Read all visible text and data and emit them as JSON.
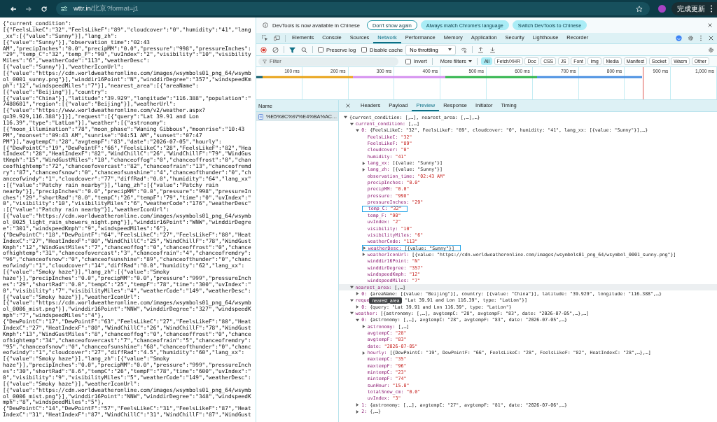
{
  "browser": {
    "url_host": "wttr.in",
    "url_rest": "/北京?format=j1",
    "update_button": "完成更新"
  },
  "raw_json_lines": [
    "{\"current_condition\":",
    "[{\"FeelsLikeC\":\"32\",\"FeelsLikeF\":\"89\",\"cloudcover\":\"0\",\"humidity\":\"41\",\"lang",
    "_xx\":[{\"value\":\"Sunny\"}],\"lang_zh\":",
    "[{\"value\":\"Sunny\"}],\"observation_time\":\"02:43",
    "AM\",\"precipInches\":\"0.0\",\"precipMM\":\"0.0\",\"pressure\":\"998\",\"pressureInches\":",
    "\"29\",\"temp_C\":\"32\",\"temp_F\":\"90\",\"uvIndex\":\"2\",\"visibility\":\"10\",\"visibility",
    "Miles\":\"6\",\"weatherCode\":\"113\",\"weatherDesc\":",
    "[{\"value\":\"Sunny\"}],\"weatherIconUrl\":",
    "[{\"value\":\"https://cdn.worldweatheronline.com/images/wsymbols01_png_64/wsymb",
    "ol_0001_sunny.png\"}],\"winddir16Point\":\"N\",\"winddirDegree\":\"357\",\"windspeedKm",
    "ph\":\"12\",\"windspeedMiles\":\"7\"}],\"nearest_area\":[{\"areaName\":",
    "[{\"value\":\"Beijing\"}],\"country\":",
    "[{\"value\":\"China\"}],\"latitude\":\"39.929\",\"longitude\":\"116.388\",\"population\":\"",
    "7480601\",\"region\":[{\"value\":\"Beijing\"}],\"weatherUrl\":",
    "[{\"value\":\"https://www.worldweatheronline.com/v2/weather.aspx?",
    "q=39.929,116.388\"}]}],\"request\":[{\"query\":\"Lat 39.91 and Lon",
    "116.39\",\"type\":\"LatLon\"}],\"weather\":[{\"astronomy\":",
    "[{\"moon_illumination\":\"78\",\"moon_phase\":\"Waning Gibbous\",\"moonrise\":\"10:43",
    "PM\",\"moonset\":\"09:43 AM\",\"sunrise\":\"04:51 AM\",\"sunset\":\"07:47",
    "PM\"}],\"avgtempC\":\"28\",\"avgtempF\":\"83\",\"date\":\"2026-07-05\",\"hourly\":",
    "[{\"DewPointC\":\"19\",\"DewPointF\":\"66\",\"FeelsLikeC\":\"28\",\"FeelsLikeF\":\"82\",\"Hea",
    "tIndexC\":\"28\",\"HeatIndexF\":\"82\",\"WindChillC\":\"26\",\"WindChillF\":\"79\",\"WindGus",
    "tKmph\":\"15\",\"WindGustMiles\":\"10\",\"chanceoffog\":\"0\",\"chanceoffrost\":\"0\",\"chan",
    "ceofhightemp\":\"72\",\"chanceofovercast\":\"82\",\"chanceofrain\":\"13\",\"chanceofremd",
    "ry\":\"87\",\"chanceofsnow\":\"0\",\"chanceofsunshine\":\"4\",\"chanceofthunder\":\"0\",\"ch",
    "anceofwindy\":\"1\",\"cloudcover\":\"77\",\"diffRad\":\"0.0\",\"humidity\":\"64\",\"lang_xx\"",
    ":[{\"value\":\"Patchy rain nearby\"}],\"lang_zh\":[{\"value\":\"Patchy rain",
    "nearby\"}],\"precipInches\":\"0.0\",\"precipMM\":\"0.0\",\"pressure\":\"998\",\"pressureIn",
    "ches\":\"29\",\"shortRad\":\"0.0\",\"tempC\":\"26\",\"tempF\":\"79\",\"time\":\"0\",\"uvIndex\":\"",
    "0\",\"visibility\":\"10\",\"visibilityMiles\":\"6\",\"weatherCode\":\"176\",\"weatherDesc\"",
    ":[{\"value\":\"Patchy rain nearby\"}],\"weatherIconUrl\":",
    "[{\"value\":\"https://cdn.worldweatheronline.com/images/wsymbols01_png_64/wsymb",
    "ol_0025_light_rain_showers_night.png\"}],\"winddir16Point\":\"WNW\",\"winddirDegre",
    "e\":\"301\",\"windspeedKmph\":\"9\",\"windspeedMiles\":\"6\"},",
    "{\"DewPointC\":\"18\",\"DewPointF\":\"64\",\"FeelsLikeC\":\"27\",\"FeelsLikeF\":\"80\",\"Heat",
    "IndexC\":\"27\",\"HeatIndexF\":\"80\",\"WindChillC\":\"25\",\"WindChillF\":\"78\",\"WindGust",
    "Kmph\":\"12\",\"WindGustMiles\":\"7\",\"chanceoffog\":\"0\",\"chanceoffrost\":\"0\",\"chance",
    "ofhightemp\":\"31\",\"chanceofovercast\":\"3\",\"chanceofrain\":\"4\",\"chanceofremdry\":",
    "\"96\",\"chanceofsnow\":\"0\",\"chanceofsunshine\":\"89\",\"chanceofthunder\":\"0\",\"chanc",
    "eofwindy\":\"1\",\"cloudcover\":\"14\",\"diffRad\":\"0.0\",\"humidity\":\"62\",\"lang_xx\":",
    "[{\"value\":\"Smoky haze\"}],\"lang_zh\":[{\"value\":\"Smoky",
    "haze\"}],\"precipInches\":\"0.0\",\"precipMM\":\"0.0\",\"pressure\":\"999\",\"pressureInch",
    "es\":\"29\",\"shortRad\":\"0.0\",\"tempC\":\"25\",\"tempF\":\"78\",\"time\":\"300\",\"uvIndex\":\"",
    "0\",\"visibility\":\"7\",\"visibilityMiles\":\"4\",\"weatherCode\":\"149\",\"weatherDesc\":",
    "[{\"value\":\"Smoky haze\"}],\"weatherIconUrl\":",
    "[{\"value\":\"https://cdn.worldweatheronline.com/images/wsymbols01_png_64/wsymb",
    "ol_0006_mist.png\"}],\"winddir16Point\":\"NNW\",\"winddirDegree\":\"327\",\"windspeedK",
    "mph\":\"7\",\"windspeedMiles\":\"4\"},",
    "{\"DewPointC\":\"17\",\"DewPointF\":\"63\",\"FeelsLikeC\":\"27\",\"FeelsLikeF\":\"80\",\"Heat",
    "IndexC\":\"27\",\"HeatIndexF\":\"80\",\"WindChillC\":\"26\",\"WindChillF\":\"78\",\"WindGust",
    "Kmph\":\"13\",\"WindGustMiles\":\"8\",\"chanceoffog\":\"0\",\"chanceoffrost\":\"0\",\"chance",
    "ofhightemp\":\"34\",\"chanceofovercast\":\"7\",\"chanceofrain\":\"5\",\"chanceofremdry\":",
    "\"95\",\"chanceofsnow\":\"0\",\"chanceofsunshine\":\"68\",\"chanceofthunder\":\"0\",\"chanc",
    "eofwindy\":\"1\",\"cloudcover\":\"27\",\"diffRad\":\"4.5\",\"humidity\":\"60\",\"lang_xx\":",
    "[{\"value\":\"Smoky haze\"}],\"lang_zh\":[{\"value\":\"Smoky",
    "haze\"}],\"precipInches\":\"0.0\",\"precipMM\":\"0.0\",\"pressure\":\"999\",\"pressureInch",
    "es\":\"30\",\"shortRad\":\"8.6\",\"tempC\":\"26\",\"tempF\":\"78\",\"time\":\"600\",\"uvIndex\":\"",
    "0\",\"visibility\":\"9\",\"visibilityMiles\":\"5\",\"weatherCode\":\"149\",\"weatherDesc\":",
    "[{\"value\":\"Smoky haze\"}],\"weatherIconUrl\":",
    "[{\"value\":\"https://cdn.worldweatheronline.com/images/wsymbols01_png_64/wsymb",
    "ol_0006_mist.png\"}],\"winddir16Point\":\"NNW\",\"winddirDegree\":\"348\",\"windspeedK",
    "mph\":\"8\",\"windspeedMiles\":\"5\"},",
    "{\"DewPointC\":\"14\",\"DewPointF\":\"57\",\"FeelsLikeC\":\"31\",\"FeelsLikeF\":\"87\",\"Heat",
    "IndexC\":\"31\",\"HeatIndexF\":\"87\",\"WindChillC\":\"31\",\"WindChillF\":\"87\",\"WindGust"
  ],
  "devtools": {
    "infobar": {
      "message": "DevTools is now available in Chinese",
      "buttons": [
        {
          "label": "Don't show again",
          "kind": "outline"
        },
        {
          "label": "Always match Chrome's language",
          "kind": "filled"
        },
        {
          "label": "Switch DevTools to Chinese",
          "kind": "filled"
        }
      ]
    },
    "panel_tabs": [
      {
        "label": "Elements",
        "selected": false
      },
      {
        "label": "Console",
        "selected": false
      },
      {
        "label": "Sources",
        "selected": false
      },
      {
        "label": "Network",
        "selected": true
      },
      {
        "label": "Performance",
        "selected": false
      },
      {
        "label": "Memory",
        "selected": false
      },
      {
        "label": "Application",
        "selected": false
      },
      {
        "label": "Security",
        "selected": false
      },
      {
        "label": "Lighthouse",
        "selected": false
      },
      {
        "label": "Recorder",
        "selected": false
      }
    ],
    "toolbar": {
      "recording": true,
      "filter_active": true,
      "checkboxes": [
        {
          "label": "Preserve log",
          "checked": false
        },
        {
          "label": "Disable cache",
          "checked": false
        }
      ],
      "throttling": "No throttling"
    },
    "filter": {
      "placeholder": "Filter",
      "invert": {
        "label": "Invert",
        "checked": false
      },
      "more_filters": "More filters",
      "types": [
        {
          "label": "All",
          "selected": true
        },
        {
          "label": "Fetch/XHR",
          "selected": false
        },
        {
          "label": "Doc",
          "selected": false
        },
        {
          "label": "CSS",
          "selected": false
        },
        {
          "label": "JS",
          "selected": false
        },
        {
          "label": "Font",
          "selected": false
        },
        {
          "label": "Img",
          "selected": false
        },
        {
          "label": "Media",
          "selected": false
        },
        {
          "label": "Manifest",
          "selected": false
        },
        {
          "label": "Socket",
          "selected": false
        },
        {
          "label": "Wasm",
          "selected": false
        },
        {
          "label": "Other",
          "selected": false
        }
      ]
    },
    "timeline": {
      "ticks": [
        "100 ms",
        "200 ms",
        "300 ms",
        "400 ms",
        "500 ms",
        "600 ms",
        "700 ms",
        "800 ms",
        "900 ms",
        "1,000 ms"
      ]
    },
    "requests": {
      "column": "Name",
      "items": [
        {
          "name": "%E5%8C%97%E4%BA%AC…",
          "selected": true
        }
      ]
    },
    "detail_tabs": [
      {
        "label": "Headers",
        "selected": false
      },
      {
        "label": "Payload",
        "selected": false
      },
      {
        "label": "Preview",
        "selected": true
      },
      {
        "label": "Response",
        "selected": false
      },
      {
        "label": "Initiator",
        "selected": false
      },
      {
        "label": "Timing",
        "selected": false
      }
    ],
    "preview": {
      "tree": [
        {
          "value": "{current_condition: [,…], nearest_area: [,…],…}",
          "kind": "summary",
          "expanded": true,
          "children": [
            {
              "key": "current_condition:",
              "value": "[,…]",
              "kind": "summary",
              "expanded": true,
              "children": [
                {
                  "key": "0:",
                  "value": "{FeelsLikeC: \"32\", FeelsLikeF: \"89\", cloudcover: \"0\", humidity: \"41\", lang_xx: [{value: \"Sunny\"}],…}",
                  "kind": "summary",
                  "expanded": true,
                  "children": [
                    {
                      "key": "FeelsLikeC:",
                      "value": "\"32\"",
                      "kind": "string"
                    },
                    {
                      "key": "FeelsLikeF:",
                      "value": "\"89\"",
                      "kind": "string"
                    },
                    {
                      "key": "cloudcover:",
                      "value": "\"0\"",
                      "kind": "string"
                    },
                    {
                      "key": "humidity:",
                      "value": "\"41\"",
                      "kind": "string"
                    },
                    {
                      "key": "lang_xx:",
                      "value": "[{value: \"Sunny\"}]",
                      "kind": "summary",
                      "expanded": false
                    },
                    {
                      "key": "lang_zh:",
                      "value": "[{value: \"Sunny\"}]",
                      "kind": "summary",
                      "expanded": false
                    },
                    {
                      "key": "observation_time:",
                      "value": "\"02:43 AM\"",
                      "kind": "string"
                    },
                    {
                      "key": "precipInches:",
                      "value": "\"0.0\"",
                      "kind": "string"
                    },
                    {
                      "key": "precipMM:",
                      "value": "\"0.0\"",
                      "kind": "string"
                    },
                    {
                      "key": "pressure:",
                      "value": "\"998\"",
                      "kind": "string"
                    },
                    {
                      "key": "pressureInches:",
                      "value": "\"29\"",
                      "kind": "string"
                    },
                    {
                      "key": "temp_C:",
                      "value": "\"32\"",
                      "kind": "string",
                      "boxed": true
                    },
                    {
                      "key": "temp_F:",
                      "value": "\"90\"",
                      "kind": "string"
                    },
                    {
                      "key": "uvIndex:",
                      "value": "\"2\"",
                      "kind": "string"
                    },
                    {
                      "key": "visibility:",
                      "value": "\"10\"",
                      "kind": "string"
                    },
                    {
                      "key": "visibilityMiles:",
                      "value": "\"6\"",
                      "kind": "string"
                    },
                    {
                      "key": "weatherCode:",
                      "value": "\"113\"",
                      "kind": "string"
                    },
                    {
                      "key": "weatherDesc:",
                      "value": "[{value: \"Sunny\"}]",
                      "kind": "summary",
                      "expanded": false,
                      "boxed": true
                    },
                    {
                      "key": "weatherIconUrl:",
                      "value": "[{value: \"https://cdn.worldweatheronline.com/images/wsymbols01_png_64/wsymbol_0001_sunny.png\"}]",
                      "kind": "summary",
                      "expanded": false
                    },
                    {
                      "key": "winddir16Point:",
                      "value": "\"N\"",
                      "kind": "string"
                    },
                    {
                      "key": "winddirDegree:",
                      "value": "\"357\"",
                      "kind": "string"
                    },
                    {
                      "key": "windspeedKmph:",
                      "value": "\"12\"",
                      "kind": "string"
                    },
                    {
                      "key": "windspeedMiles:",
                      "value": "\"7\"",
                      "kind": "string"
                    }
                  ]
                }
              ]
            },
            {
              "key": "nearest_area:",
              "value": "[,…]",
              "kind": "summary",
              "expanded": true,
              "hovered": true,
              "children": [
                {
                  "key": "0:",
                  "value": "{areaName: [{value: \"Beijing\"}], country: [{value: \"China\"}], latitude: \"39.929\", longitude: \"116.388\",…}",
                  "kind": "summary",
                  "expanded": false
                }
              ]
            },
            {
              "key": "reque",
              "tooltip": "nearest_area",
              "value": "\"Lat 39.91 and Lon 116.39\", type: \"LatLon\"}]",
              "kind": "summary",
              "expanded": true,
              "children": [
                {
                  "key": "0:",
                  "value": "{query: \"Lat 39.91 and Lon 116.39\", type: \"LatLon\"}",
                  "kind": "summary",
                  "expanded": false
                }
              ]
            },
            {
              "key": "weather:",
              "value": "[{astronomy: [,…], avgtempC: \"28\", avgtempF: \"83\", date: \"2026-07-05\",…},…]",
              "kind": "summary",
              "expanded": true,
              "children": [
                {
                  "key": "0:",
                  "value": "{astronomy: [,…], avgtempC: \"28\", avgtempF: \"83\", date: \"2026-07-05\",…}",
                  "kind": "summary",
                  "expanded": true,
                  "children": [
                    {
                      "key": "astronomy:",
                      "value": "[,…]",
                      "kind": "summary",
                      "expanded": false
                    },
                    {
                      "key": "avgtempC:",
                      "value": "\"28\"",
                      "kind": "string"
                    },
                    {
                      "key": "avgtempF:",
                      "value": "\"83\"",
                      "kind": "string"
                    },
                    {
                      "key": "date:",
                      "value": "\"2026-07-05\"",
                      "kind": "string"
                    },
                    {
                      "key": "hourly:",
                      "value": "[{DewPointC: \"19\", DewPointF: \"66\", FeelsLikeC: \"28\", FeelsLikeF: \"82\", HeatIndexC: \"28\",…},…]",
                      "kind": "summary",
                      "expanded": false
                    },
                    {
                      "key": "maxtempC:",
                      "value": "\"35\"",
                      "kind": "string"
                    },
                    {
                      "key": "maxtempF:",
                      "value": "\"96\"",
                      "kind": "string"
                    },
                    {
                      "key": "mintempC:",
                      "value": "\"23\"",
                      "kind": "string"
                    },
                    {
                      "key": "mintempF:",
                      "value": "\"74\"",
                      "kind": "string"
                    },
                    {
                      "key": "sunHour:",
                      "value": "\"15.0\"",
                      "kind": "string"
                    },
                    {
                      "key": "totalSnow_cm:",
                      "value": "\"0.0\"",
                      "kind": "string"
                    },
                    {
                      "key": "uvIndex:",
                      "value": "\"3\"",
                      "kind": "string"
                    }
                  ]
                },
                {
                  "key": "1:",
                  "value": "{astronomy: [,…], avgtempC: \"27\", avgtempF: \"81\", date: \"2026-07-06\",…}",
                  "kind": "summary",
                  "expanded": false
                },
                {
                  "key": "2:",
                  "value": "{,…}",
                  "kind": "summary",
                  "expanded": false
                }
              ]
            }
          ]
        }
      ]
    }
  }
}
